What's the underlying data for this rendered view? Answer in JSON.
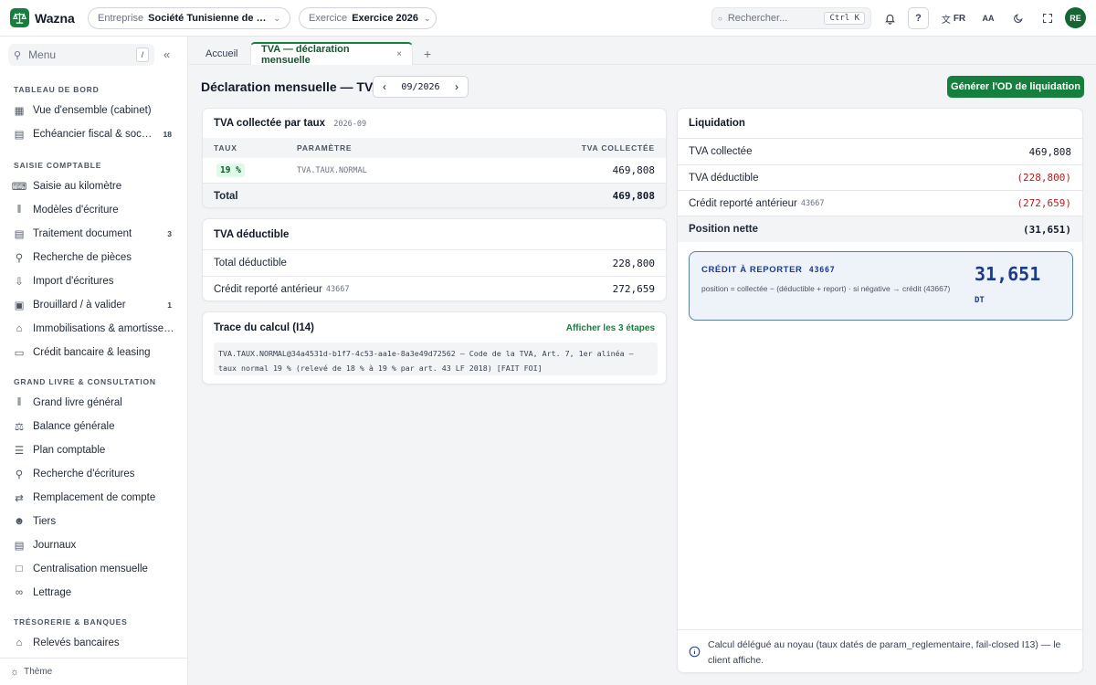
{
  "app": {
    "brand": "Wazna"
  },
  "topbar": {
    "entreprise_label": "Entreprise",
    "entreprise_value": "Société Tunisienne de Pla…",
    "exercice_label": "Exercice",
    "exercice_value": "Exercice 2026",
    "search_placeholder": "Rechercher...",
    "search_shortcut": "Ctrl K",
    "help": "?",
    "lang": "FR",
    "font_size": "AA",
    "avatar": "RE"
  },
  "sidebar": {
    "search_label": "Menu",
    "search_shortcut": "/",
    "sections": [
      {
        "title": "TABLEAU DE BORD",
        "items": [
          {
            "label": "Vue d'ensemble (cabinet)",
            "icon": "dashboard-icon",
            "badge": ""
          },
          {
            "label": "Échéancier fiscal & soc…",
            "icon": "calendar-icon",
            "badge": "18"
          }
        ]
      },
      {
        "title": "SAISIE COMPTABLE",
        "items": [
          {
            "label": "Saisie au kilomètre",
            "icon": "keyboard-icon",
            "badge": ""
          },
          {
            "label": "Modèles d'écriture",
            "icon": "library-icon",
            "badge": ""
          },
          {
            "label": "Traitement document",
            "icon": "document-icon",
            "badge": "3"
          },
          {
            "label": "Recherche de pièces",
            "icon": "search-icon",
            "badge": ""
          },
          {
            "label": "Import d'écritures",
            "icon": "upload-icon",
            "badge": ""
          },
          {
            "label": "Brouillard / à valider",
            "icon": "drafts-icon",
            "badge": "1"
          },
          {
            "label": "Immobilisations & amortisse…",
            "icon": "bank-icon",
            "badge": ""
          },
          {
            "label": "Crédit bancaire & leasing",
            "icon": "credit-card-icon",
            "badge": ""
          }
        ]
      },
      {
        "title": "GRAND LIVRE & CONSULTATION",
        "items": [
          {
            "label": "Grand livre général",
            "icon": "library-icon",
            "badge": ""
          },
          {
            "label": "Balance générale",
            "icon": "scale-icon",
            "badge": ""
          },
          {
            "label": "Plan comptable",
            "icon": "list-icon",
            "badge": ""
          },
          {
            "label": "Recherche d'écritures",
            "icon": "search-icon",
            "badge": ""
          },
          {
            "label": "Remplacement de compte",
            "icon": "swap-icon",
            "badge": ""
          },
          {
            "label": "Tiers",
            "icon": "users-icon",
            "badge": ""
          },
          {
            "label": "Journaux",
            "icon": "book-icon",
            "badge": ""
          },
          {
            "label": "Centralisation mensuelle",
            "icon": "file-icon",
            "badge": ""
          },
          {
            "label": "Lettrage",
            "icon": "link-icon",
            "badge": ""
          }
        ]
      },
      {
        "title": "TRÉSORERIE & BANQUES",
        "items": [
          {
            "label": "Relevés bancaires",
            "icon": "bank-icon",
            "badge": ""
          }
        ]
      }
    ],
    "theme_label": "Thème"
  },
  "tabs": {
    "home": "Accueil",
    "active": "TVA — déclaration mensuelle",
    "close": "×",
    "add": "+"
  },
  "page": {
    "title": "Déclaration mensuelle — TVA",
    "period": "09/2026",
    "generate_button": "Générer l'OD de liquidation"
  },
  "collected": {
    "title": "TVA collectée par taux",
    "period_tag": "2026-09",
    "headers": [
      "TAUX",
      "PARAMÈTRE",
      "TVA COLLECTÉE"
    ],
    "rows": [
      {
        "rate": "19 %",
        "param": "TVA.TAUX.NORMAL",
        "amount": "469,808"
      }
    ],
    "total_label": "Total",
    "total_amount": "469,808"
  },
  "deductible": {
    "title": "TVA déductible",
    "total_label": "Total déductible",
    "total_amount": "228,800",
    "prior_label": "Crédit reporté antérieur",
    "prior_account": "43667",
    "prior_amount": "272,659"
  },
  "trace": {
    "title": "Trace du calcul (I14)",
    "link": "Afficher les 3 étapes",
    "text": "TVA.TAUX.NORMAL@34a4531d-b1f7-4c53-aa1e-8a3e49d72562 — Code de la TVA, Art. 7, 1er alinéa — taux normal 19 % (relevé de 18 % à 19 % par art. 43 LF 2018) [FAIT FOI]"
  },
  "liquidation": {
    "title": "Liquidation",
    "rows": [
      {
        "label": "TVA collectée",
        "account": "",
        "amount": "469,808"
      },
      {
        "label": "TVA déductible",
        "account": "",
        "amount": "(228,800)"
      },
      {
        "label": "Crédit reporté antérieur",
        "account": "43667",
        "amount": "(272,659)"
      }
    ],
    "net_label": "Position nette",
    "net_amount": "(31,651)",
    "credit_title": "CRÉDIT À REPORTER",
    "credit_account": "43667",
    "credit_formula": "position = collectée − (déductible + report) · si négative → crédit (43667)",
    "credit_amount": "31,651",
    "credit_currency": "DT",
    "note": "Calcul délégué au noyau (taux datés de param_reglementaire, fail-closed I13) — le client affiche."
  },
  "colors": {
    "accent": "#15803d",
    "negative": "#b91c1c",
    "credit_bg": "#eef2f9",
    "credit_amount": "#1e3a8a"
  }
}
